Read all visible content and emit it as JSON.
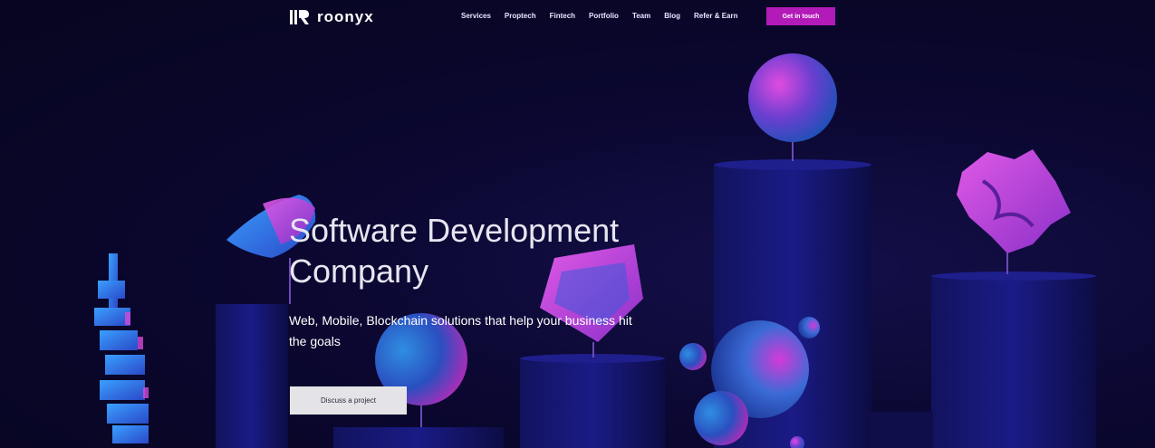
{
  "header": {
    "logo_text": "roonyx",
    "nav": [
      {
        "label": "Services"
      },
      {
        "label": "Proptech"
      },
      {
        "label": "Fintech"
      },
      {
        "label": "Portfolio"
      },
      {
        "label": "Team"
      },
      {
        "label": "Blog"
      },
      {
        "label": "Refer & Earn"
      }
    ],
    "cta_label": "Get in touch"
  },
  "hero": {
    "title": "Software Development Company",
    "subtitle": "Web, Mobile, Blockchain solutions that help your business hit the goals",
    "cta_label": "Discuss a project"
  },
  "colors": {
    "background": "#0a0628",
    "accent": "#b21bb8",
    "button_secondary": "#e4e4e8"
  },
  "icons": {
    "logo": "roonyx-logo-mark"
  }
}
